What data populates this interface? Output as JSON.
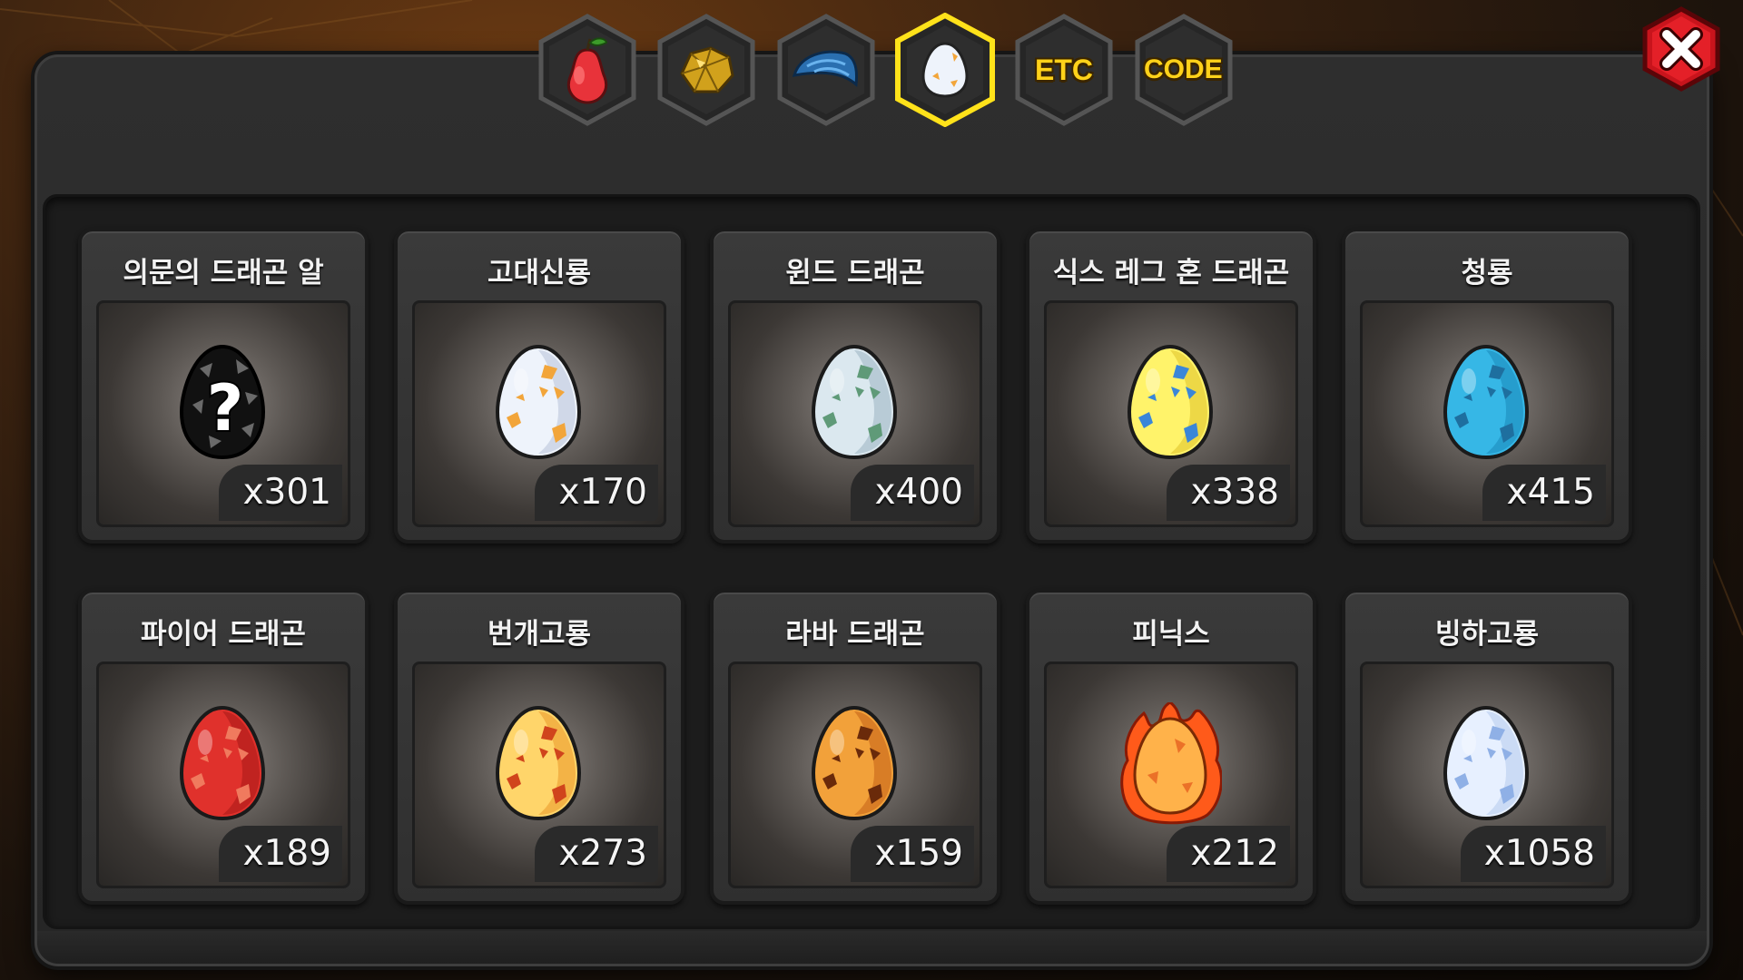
{
  "tabs": [
    {
      "id": "fruit",
      "icon": "red-pear-fruit-icon",
      "label": "",
      "active": false
    },
    {
      "id": "ore",
      "icon": "gold-ore-icon",
      "label": "",
      "active": false
    },
    {
      "id": "scale",
      "icon": "blue-scale-icon",
      "label": "",
      "active": false
    },
    {
      "id": "egg",
      "icon": "egg-icon",
      "label": "",
      "active": true
    },
    {
      "id": "etc",
      "icon": "",
      "label": "ETC",
      "active": false
    },
    {
      "id": "code",
      "icon": "",
      "label": "CODE",
      "active": false
    }
  ],
  "close": {
    "icon": "close-icon"
  },
  "items_row1": [
    {
      "name": "의문의 드래곤 알",
      "count": "x301",
      "egg": "mystery",
      "colors": [
        "#3a3a3a",
        "#111111",
        "#6a6a6a"
      ]
    },
    {
      "name": "고대신룡",
      "count": "x170",
      "egg": "spotted",
      "colors": [
        "#eef3fb",
        "#aab8d0",
        "#f2a53a"
      ]
    },
    {
      "name": "윈드 드래곤",
      "count": "x400",
      "egg": "spotted",
      "colors": [
        "#dbe8ef",
        "#8fa9b8",
        "#5f9a78"
      ]
    },
    {
      "name": "식스 레그 혼 드래곤",
      "count": "x338",
      "egg": "spotted",
      "colors": [
        "#fff36a",
        "#d6b81a",
        "#3a86d8"
      ]
    },
    {
      "name": "청룡",
      "count": "x415",
      "egg": "spotted",
      "colors": [
        "#36b7e6",
        "#137fb0",
        "#1e6f9f"
      ]
    }
  ],
  "items_row2": [
    {
      "name": "파이어 드래곤",
      "count": "x189",
      "egg": "spotted",
      "colors": [
        "#e0312c",
        "#9a1512",
        "#f07a5e"
      ]
    },
    {
      "name": "번개고룡",
      "count": "x273",
      "egg": "spotted",
      "colors": [
        "#ffd56a",
        "#e58a1a",
        "#d0441c"
      ]
    },
    {
      "name": "라바 드래곤",
      "count": "x159",
      "egg": "spotted",
      "colors": [
        "#f2a13a",
        "#b8520f",
        "#6a2a0a"
      ]
    },
    {
      "name": "피닉스",
      "count": "x212",
      "egg": "flame",
      "colors": [
        "#ffb24a",
        "#e2561a",
        "#ff5a1a"
      ]
    },
    {
      "name": "빙하고룡",
      "count": "x1058",
      "egg": "spotted",
      "colors": [
        "#e7f0ff",
        "#a8c0e8",
        "#8fb0e6"
      ]
    }
  ]
}
